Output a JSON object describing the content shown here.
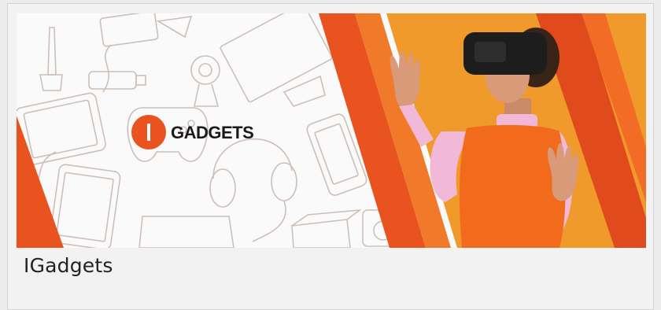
{
  "card": {
    "title": "IGadgets"
  },
  "banner": {
    "logo_text": "GADGETS",
    "logo_mark": "I"
  },
  "colors": {
    "accent": "#e8531f",
    "accent_dark": "#d8401a",
    "orange_bg": "#f0982a",
    "sketch": "#c9b8b0",
    "text": "#222222"
  }
}
